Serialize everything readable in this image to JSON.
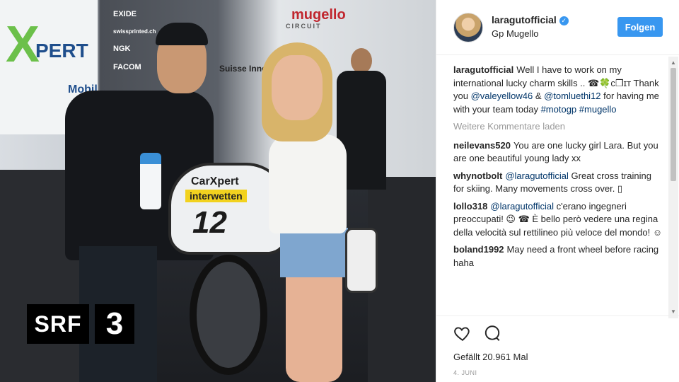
{
  "photo": {
    "sponsor_xpert_x": "X",
    "sponsor_xpert_text": "PERT",
    "sponsor_mobil": "Mobil",
    "sponsor_column": [
      "EXIDE",
      "swissprinted.ch",
      "NGK",
      "FACOM"
    ],
    "track_name": "mugello",
    "track_subtitle": "CIRCUIT",
    "suisse_text": "Suisse Innovat",
    "bike_logo": "CarXpert",
    "bike_sponsor": "interwetten",
    "bike_number": "12"
  },
  "watermark": {
    "srf_text": "SRF",
    "channel_number": "3"
  },
  "post": {
    "username": "laragutofficial",
    "location": "Gp Mugello",
    "follow_label": "Folgen",
    "caption": {
      "author": "laragutofficial",
      "text_1": "Well I have to work on my international lucky charm skills .. ☎🍀ᴄ❒ɪᴛ Thank you ",
      "mention_1": "@valeyellow46",
      "text_2": " & ",
      "mention_2": "@tomluethi12",
      "text_3": " for having me with your team today ",
      "hashtag_1": "#motogp",
      "text_4": " ",
      "hashtag_2": "#mugello"
    },
    "load_more_label": "Weitere Kommentare laden",
    "comments": [
      {
        "author": "neilevans520",
        "mention": "",
        "text": "You are one lucky girl Lara. But you are one beautiful young lady xx"
      },
      {
        "author": "whynotbolt",
        "mention": "@laragutofficial",
        "text": " Great cross training for skiing. Many movements cross over. ▯"
      },
      {
        "author": "lollo318",
        "mention": "@laragutofficial",
        "text": " c'erano ingegneri preoccupati! 😉 ☎ È bello però vedere una regina della velocità sul rettilineo più veloce del mondo! ☺"
      },
      {
        "author": "boland1992",
        "mention": "",
        "text": "May need a front wheel before racing haha"
      }
    ],
    "likes_text": "Gefällt 20.961 Mal",
    "date_text": "4. JUNI"
  }
}
